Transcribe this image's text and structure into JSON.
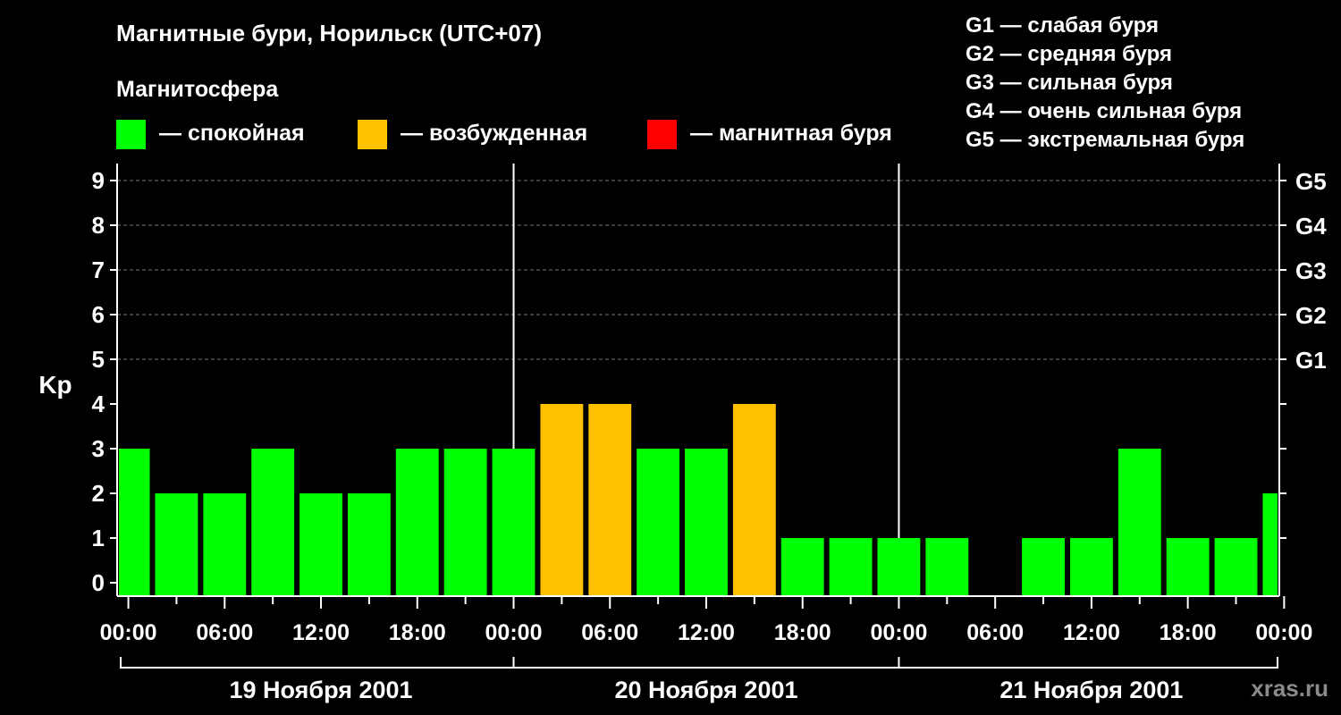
{
  "header": {
    "title": "Магнитные бури, Норильск (UTC+07)",
    "legend_title": "Магнитосфера"
  },
  "legend": [
    {
      "color": "#00ff00",
      "label": "— спокойная"
    },
    {
      "color": "#ffc000",
      "label": "— возбужденная"
    },
    {
      "color": "#ff0000",
      "label": "— магнитная буря"
    }
  ],
  "storm_levels": [
    {
      "code": "G1",
      "label": "G1 — слабая буря"
    },
    {
      "code": "G2",
      "label": "G2 — средняя буря"
    },
    {
      "code": "G3",
      "label": "G3 — сильная буря"
    },
    {
      "code": "G4",
      "label": "G4 — очень сильная буря"
    },
    {
      "code": "G5",
      "label": "G5 — экстремальная буря"
    }
  ],
  "watermark": "xras.ru",
  "chart_data": {
    "type": "bar",
    "ylabel": "Kp",
    "ylim": [
      0,
      9
    ],
    "yticks": [
      "0",
      "1",
      "2",
      "3",
      "4",
      "5",
      "6",
      "7",
      "8",
      "9"
    ],
    "right_ticks": [
      {
        "kp": 5,
        "label": "G1"
      },
      {
        "kp": 6,
        "label": "G2"
      },
      {
        "kp": 7,
        "label": "G3"
      },
      {
        "kp": 8,
        "label": "G4"
      },
      {
        "kp": 9,
        "label": "G5"
      }
    ],
    "x_tick_labels": [
      "00:00",
      "06:00",
      "12:00",
      "18:00",
      "00:00",
      "06:00",
      "12:00",
      "18:00",
      "00:00",
      "06:00",
      "12:00",
      "18:00",
      "00:00"
    ],
    "days": [
      "19 Ноября 2001",
      "20 Ноября 2001",
      "21 Ноября 2001"
    ],
    "hour_start": -0.7,
    "hour_end": 71.7,
    "bar_hours": [
      0,
      3,
      6,
      9,
      12,
      15,
      18,
      21,
      24,
      27,
      30,
      33,
      36,
      39,
      42,
      45,
      48,
      51,
      54,
      57,
      60,
      63,
      66,
      69,
      72
    ],
    "values": [
      3,
      2,
      2,
      3,
      2,
      2,
      3,
      3,
      3,
      4,
      4,
      3,
      3,
      4,
      1,
      1,
      1,
      1,
      0,
      1,
      1,
      3,
      1,
      1,
      2
    ],
    "colors": {
      "quiet": "#00ff00",
      "active": "#ffc000",
      "storm": "#ff0000"
    },
    "grid": true
  }
}
